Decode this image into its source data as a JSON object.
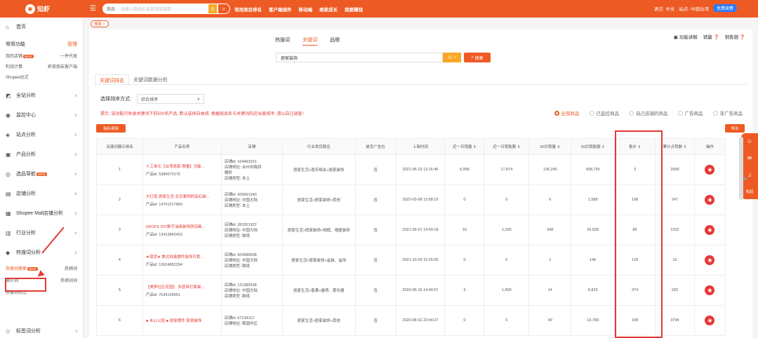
{
  "topbar": {
    "logo": "知虾",
    "search_category": "商品",
    "search_placeholder": "选输入商品ID或者商品链接",
    "nav": [
      "常用类目排名",
      "客户端插件",
      "移动端",
      "商家成长",
      "我要赚钱"
    ],
    "language": "语言: 中文",
    "site": "站点: 中国台湾",
    "vip": "免费续费"
  },
  "sidebar": {
    "home": "首页",
    "common_functions": "常用功能",
    "manage": "管理",
    "quick_links": [
      "我的店铺",
      "一件代发",
      "利润计算",
      "虾皮朋友客户端",
      "Shopee达式"
    ],
    "items": [
      "全站分析",
      "监控中心",
      "站点分析",
      "产品分析",
      "选品导航",
      "店铺分析",
      "Shopee Mall店铺分析",
      "行业分析",
      "热搜词分析",
      "标签词分析"
    ],
    "new_badge": "NEW",
    "hot_words_sub": [
      "热搜词搜索",
      "热销词",
      "飙升词",
      "热销词词",
      "热搜词对比"
    ]
  },
  "tagbar": {
    "tag": "搜索"
  },
  "main": {
    "tabs": [
      "热搜词",
      "关键词",
      "品牌"
    ],
    "active_tab": "关键词",
    "func_links": [
      "功能讲解",
      "销量",
      "销售额"
    ],
    "keyword_value": "居家装饰",
    "search_button": "搜索",
    "subtabs": [
      "关键词排名",
      "关键词数据分析"
    ],
    "sort_label": "选择排序方式:",
    "sort_value": "综合排序",
    "tip": "提示: 该功能只收录关键词下前500名产品, 默认选择自由排, 根据商品名与关键词的近似度排序, 请以自己调查!",
    "radios": [
      "全部商品",
      "已监控商品",
      "自己店铺的商品",
      "广告商品",
      "非广告商品"
    ],
    "add_button": "指标调用",
    "export_button": "导出",
    "columns": [
      "关键词展示排名",
      "产品名称",
      "店铺",
      "行业类目路径",
      "是否广告位",
      "上架时间",
      "近一日销量",
      "近一日销售额",
      "30日销量",
      "30日销售额",
      "售价",
      "累计点赞数",
      "操作"
    ],
    "rows": [
      {
        "rank": "1",
        "name": "人工单元【台湾商家-限量】功能...",
        "pid": "产品id: 5389670176",
        "shop": [
          "店铺id: 164493291",
          "店铺地址: 台州市路西",
          "棚桥",
          "店铺类型: 本土"
        ],
        "cat": "居家生活>喜庆相关>居家装饰",
        "ad": "否",
        "date": "2021-05-23 13:16:46",
        "d1s": "5,958",
        "d1r": "17,874",
        "d30s": "136,245",
        "d30r": "408,735",
        "price": "3",
        "likes": "2968"
      },
      {
        "rank": "2",
        "name": "大灯笼 居家生活-北京案例的高幻装...",
        "pid": "产品id: 14761217860",
        "shop": [
          "店铺id: 426691340",
          "店铺地址: 中国大陆",
          "店铺类型: 本土"
        ],
        "cat": "居家生活>居家装饰>其他",
        "ad": "否",
        "date": "2022-03-08 13:58:19",
        "d1s": "0",
        "d1r": "0",
        "d30s": "6",
        "d30r": "1,588",
        "price": "198",
        "likes": "247"
      },
      {
        "rank": "3",
        "name": "DROFE DIY数字油画装饰房间画...",
        "pid": "产品id: 13413842453",
        "shop": [
          "店铺id: 281551922",
          "店铺地址: 中国大陆",
          "店铺类型: 跨境"
        ],
        "cat": "居家生活>居家装饰>相框、墙壁装饰",
        "ad": "否",
        "date": "2021-09-21 14:59:18",
        "d1s": "15",
        "d1r": "1,290",
        "d30s": "348",
        "d30r": "29,928",
        "price": "86",
        "likes": "1322"
      },
      {
        "rank": "4",
        "name": "★现货★ 美式风格摆件装饰可爱...",
        "pid": "产品id: 13624852294",
        "shop": [
          "店铺id: 504586698",
          "店铺地址: 中国大陆",
          "店铺类型: 跨境"
        ],
        "cat": "居家生活>居家装饰>盒装、盒饰",
        "ad": "否",
        "date": "2021-10-09 15:25:05",
        "d1s": "0",
        "d1r": "0",
        "d30s": "1",
        "d30r": "146",
        "price": "118",
        "likes": "16"
      },
      {
        "rank": "5",
        "name": "【美梦社区花园】 多层带灯家装...",
        "pid": "产品id: 7534149951",
        "shop": [
          "店铺id: 131385538",
          "店铺地址: 中国大陆",
          "店铺类型: 跨境"
        ],
        "cat": "居家生活>香薰>露喷、雾化器",
        "ad": "否",
        "date": "2020-05-16 14:49:57",
        "d1s": "3",
        "d1r": "1,890",
        "d30s": "14",
        "d30r": "8,829",
        "price": "374",
        "likes": "293"
      },
      {
        "rank": "6",
        "name": "♣ 未心公园 ♣ 居家摆件 家居装饰",
        "pid": "",
        "shop": [
          "店铺id: 67134112",
          "店铺地址: 韩国市区"
        ],
        "cat": "居家生活>居家装饰>其他",
        "ad": "否",
        "date": "2020-08-02 23:44:27",
        "d1s": "0",
        "d1r": "0",
        "d30s": "49",
        "d30r": "19,789",
        "price": "198",
        "likes": "3794"
      }
    ],
    "action_icon": "eye-icon"
  },
  "float_bar": {
    "label": "收起"
  }
}
